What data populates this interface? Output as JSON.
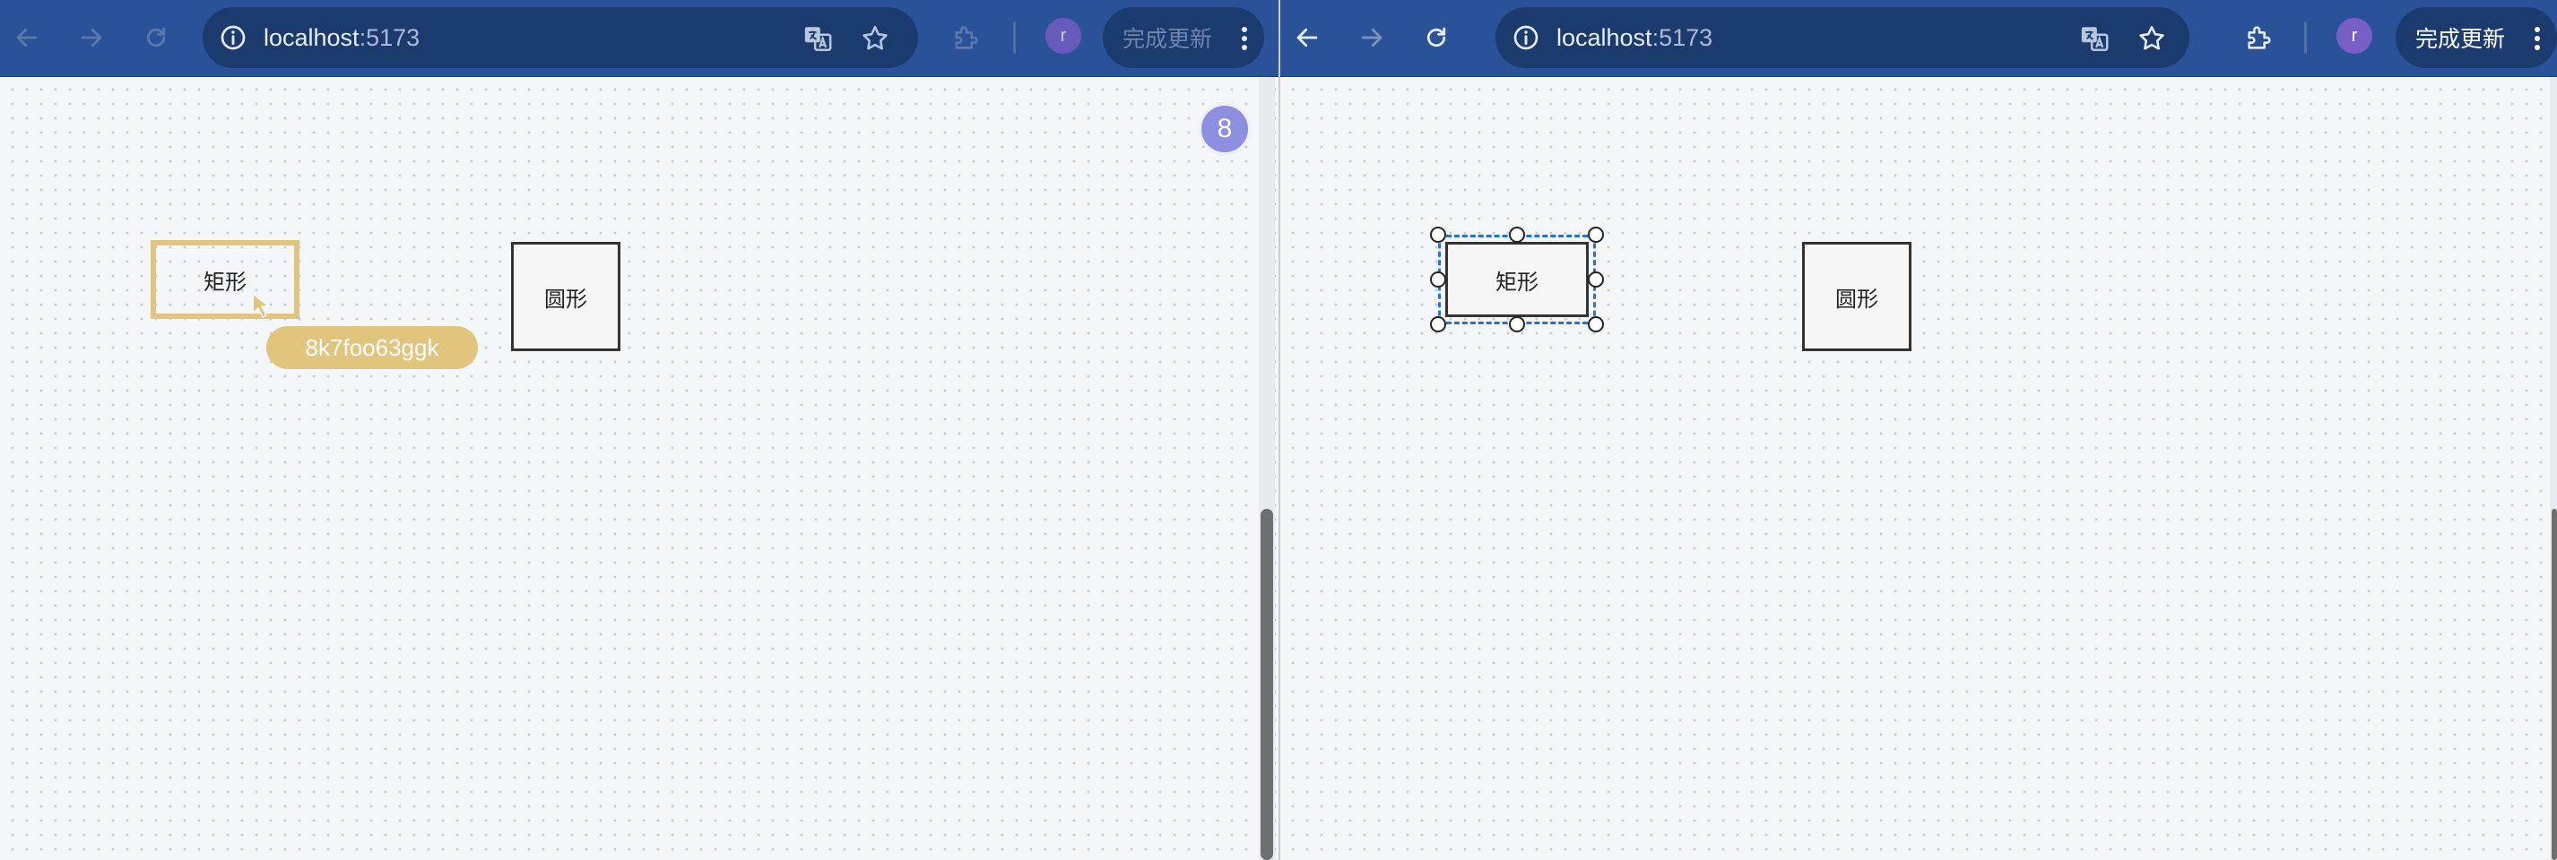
{
  "colors": {
    "toolbar_bg": "#2a5298",
    "omnibox_bg": "#1b3a6e",
    "remote_selection": "#e2c57d",
    "avatar": "#7a5ec8",
    "badge": "#8d8fe0",
    "canvas_bg": "#f4f7f9",
    "local_selection": "#2a6fd6"
  },
  "windows": [
    {
      "id": "left",
      "address": {
        "host": "localhost",
        "port": ":5173"
      },
      "avatar_initial": "r",
      "update_button": "完成更新",
      "badge_count": "8",
      "shapes": {
        "rect_label": "矩形",
        "circle_label": "圆形"
      },
      "remote_user_tag": "8k7foo63ggk"
    },
    {
      "id": "right",
      "address": {
        "host": "localhost",
        "port": ":5173"
      },
      "avatar_initial": "r",
      "update_button": "完成更新",
      "shapes": {
        "rect_label": "矩形",
        "circle_label": "圆形"
      }
    }
  ],
  "icons": {
    "back": "arrow-left-icon",
    "forward": "arrow-right-icon",
    "reload": "reload-icon",
    "site_info": "info-icon",
    "translate": "translate-icon",
    "bookmark": "star-icon",
    "extensions": "puzzle-icon",
    "menu": "more-vertical-icon",
    "cursor": "cursor-icon"
  }
}
